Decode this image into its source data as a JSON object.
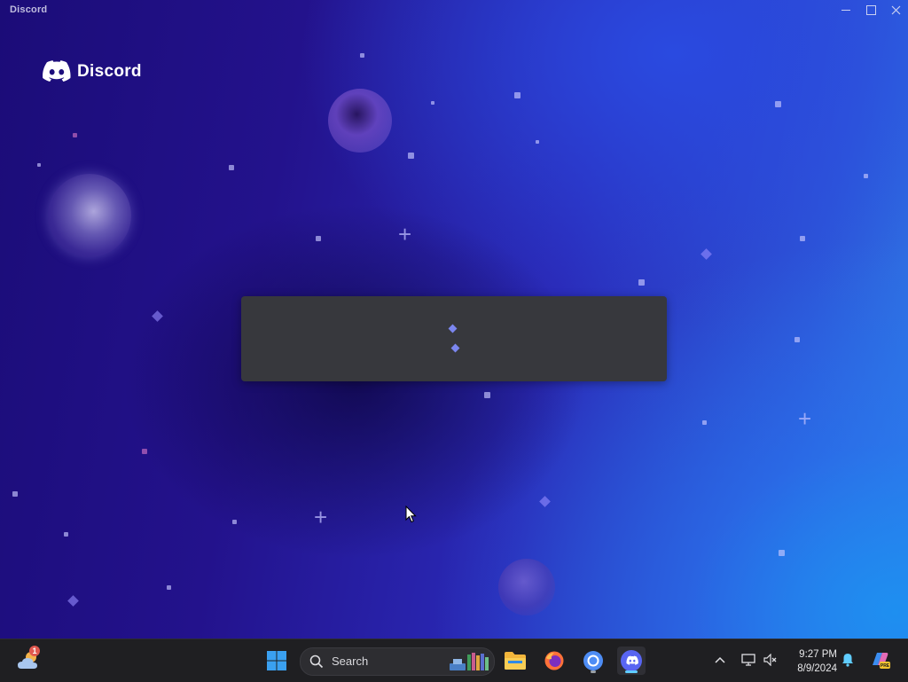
{
  "window": {
    "title": "Discord",
    "brand_name": "Discord"
  },
  "loading": {
    "state": "loading"
  },
  "taskbar": {
    "search_placeholder": "Search",
    "weather_badge": "1",
    "clock": {
      "time": "9:27 PM",
      "date": "8/9/2024"
    },
    "pinned": [
      "start-icon",
      "file-explorer-icon",
      "firefox-icon",
      "chrome-icon",
      "discord-icon"
    ]
  },
  "colors": {
    "accent": "#5865f2",
    "panel": "#37383d",
    "taskbar": "#1f1f22"
  }
}
